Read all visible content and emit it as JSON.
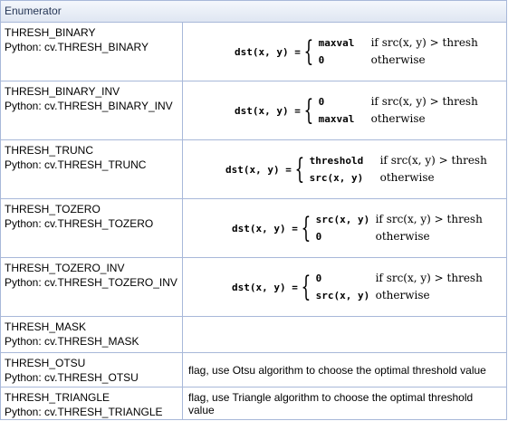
{
  "header": {
    "title": "Enumerator"
  },
  "rows": [
    {
      "name": "THRESH_BINARY",
      "python": "Python: cv.THRESH_BINARY",
      "lhs": "dst(x, y) =",
      "case1_value": "maxval",
      "case1_condition": "if src(x, y) > thresh",
      "case2_value": "0",
      "case2_condition": "otherwise"
    },
    {
      "name": "THRESH_BINARY_INV",
      "python": "Python: cv.THRESH_BINARY_INV",
      "lhs": "dst(x, y) =",
      "case1_value": "0",
      "case1_condition": "if src(x, y) > thresh",
      "case2_value": "maxval",
      "case2_condition": "otherwise"
    },
    {
      "name": "THRESH_TRUNC",
      "python": "Python: cv.THRESH_TRUNC",
      "lhs": "dst(x, y) =",
      "case1_value": "threshold",
      "case1_condition": "if src(x, y) > thresh",
      "case2_value": "src(x, y)",
      "case2_condition": "otherwise"
    },
    {
      "name": "THRESH_TOZERO",
      "python": "Python: cv.THRESH_TOZERO",
      "lhs": "dst(x, y) =",
      "case1_value": "src(x, y)",
      "case1_condition": "if src(x, y) > thresh",
      "case2_value": "0",
      "case2_condition": "otherwise"
    },
    {
      "name": "THRESH_TOZERO_INV",
      "python": "Python: cv.THRESH_TOZERO_INV",
      "lhs": "dst(x, y) =",
      "case1_value": "0",
      "case1_condition": "if src(x, y) > thresh",
      "case2_value": "src(x, y)",
      "case2_condition": "otherwise"
    },
    {
      "name": "THRESH_MASK",
      "python": "Python: cv.THRESH_MASK",
      "description": ""
    },
    {
      "name": "THRESH_OTSU",
      "python": "Python: cv.THRESH_OTSU",
      "description": "flag, use Otsu algorithm to choose the optimal threshold value"
    },
    {
      "name": "THRESH_TRIANGLE",
      "python": "Python: cv.THRESH_TRIANGLE",
      "description": "flag, use Triangle algorithm to choose the optimal threshold value"
    }
  ],
  "colors": {
    "border": "#a8b8d9",
    "header_bg": "#dfe6f2",
    "header_text": "#253555"
  }
}
